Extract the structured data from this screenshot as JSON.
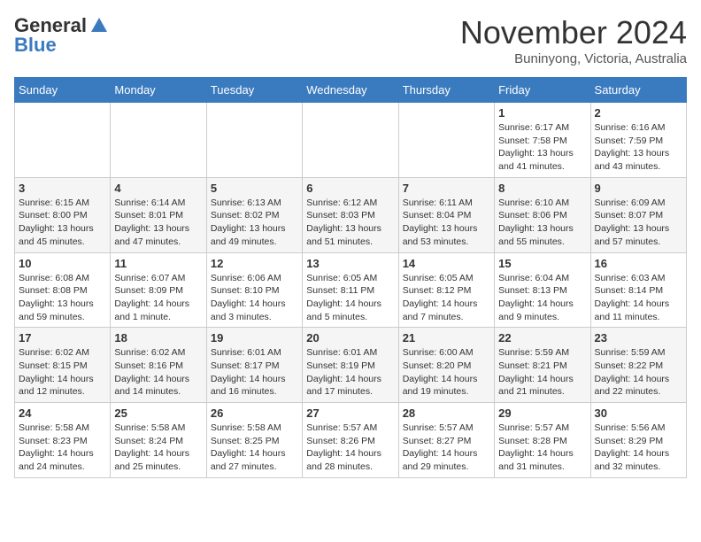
{
  "header": {
    "logo_general": "General",
    "logo_blue": "Blue",
    "month": "November 2024",
    "location": "Buninyong, Victoria, Australia"
  },
  "weekdays": [
    "Sunday",
    "Monday",
    "Tuesday",
    "Wednesday",
    "Thursday",
    "Friday",
    "Saturday"
  ],
  "weeks": [
    [
      {
        "day": "",
        "info": ""
      },
      {
        "day": "",
        "info": ""
      },
      {
        "day": "",
        "info": ""
      },
      {
        "day": "",
        "info": ""
      },
      {
        "day": "",
        "info": ""
      },
      {
        "day": "1",
        "info": "Sunrise: 6:17 AM\nSunset: 7:58 PM\nDaylight: 13 hours\nand 41 minutes."
      },
      {
        "day": "2",
        "info": "Sunrise: 6:16 AM\nSunset: 7:59 PM\nDaylight: 13 hours\nand 43 minutes."
      }
    ],
    [
      {
        "day": "3",
        "info": "Sunrise: 6:15 AM\nSunset: 8:00 PM\nDaylight: 13 hours\nand 45 minutes."
      },
      {
        "day": "4",
        "info": "Sunrise: 6:14 AM\nSunset: 8:01 PM\nDaylight: 13 hours\nand 47 minutes."
      },
      {
        "day": "5",
        "info": "Sunrise: 6:13 AM\nSunset: 8:02 PM\nDaylight: 13 hours\nand 49 minutes."
      },
      {
        "day": "6",
        "info": "Sunrise: 6:12 AM\nSunset: 8:03 PM\nDaylight: 13 hours\nand 51 minutes."
      },
      {
        "day": "7",
        "info": "Sunrise: 6:11 AM\nSunset: 8:04 PM\nDaylight: 13 hours\nand 53 minutes."
      },
      {
        "day": "8",
        "info": "Sunrise: 6:10 AM\nSunset: 8:06 PM\nDaylight: 13 hours\nand 55 minutes."
      },
      {
        "day": "9",
        "info": "Sunrise: 6:09 AM\nSunset: 8:07 PM\nDaylight: 13 hours\nand 57 minutes."
      }
    ],
    [
      {
        "day": "10",
        "info": "Sunrise: 6:08 AM\nSunset: 8:08 PM\nDaylight: 13 hours\nand 59 minutes."
      },
      {
        "day": "11",
        "info": "Sunrise: 6:07 AM\nSunset: 8:09 PM\nDaylight: 14 hours\nand 1 minute."
      },
      {
        "day": "12",
        "info": "Sunrise: 6:06 AM\nSunset: 8:10 PM\nDaylight: 14 hours\nand 3 minutes."
      },
      {
        "day": "13",
        "info": "Sunrise: 6:05 AM\nSunset: 8:11 PM\nDaylight: 14 hours\nand 5 minutes."
      },
      {
        "day": "14",
        "info": "Sunrise: 6:05 AM\nSunset: 8:12 PM\nDaylight: 14 hours\nand 7 minutes."
      },
      {
        "day": "15",
        "info": "Sunrise: 6:04 AM\nSunset: 8:13 PM\nDaylight: 14 hours\nand 9 minutes."
      },
      {
        "day": "16",
        "info": "Sunrise: 6:03 AM\nSunset: 8:14 PM\nDaylight: 14 hours\nand 11 minutes."
      }
    ],
    [
      {
        "day": "17",
        "info": "Sunrise: 6:02 AM\nSunset: 8:15 PM\nDaylight: 14 hours\nand 12 minutes."
      },
      {
        "day": "18",
        "info": "Sunrise: 6:02 AM\nSunset: 8:16 PM\nDaylight: 14 hours\nand 14 minutes."
      },
      {
        "day": "19",
        "info": "Sunrise: 6:01 AM\nSunset: 8:17 PM\nDaylight: 14 hours\nand 16 minutes."
      },
      {
        "day": "20",
        "info": "Sunrise: 6:01 AM\nSunset: 8:19 PM\nDaylight: 14 hours\nand 17 minutes."
      },
      {
        "day": "21",
        "info": "Sunrise: 6:00 AM\nSunset: 8:20 PM\nDaylight: 14 hours\nand 19 minutes."
      },
      {
        "day": "22",
        "info": "Sunrise: 5:59 AM\nSunset: 8:21 PM\nDaylight: 14 hours\nand 21 minutes."
      },
      {
        "day": "23",
        "info": "Sunrise: 5:59 AM\nSunset: 8:22 PM\nDaylight: 14 hours\nand 22 minutes."
      }
    ],
    [
      {
        "day": "24",
        "info": "Sunrise: 5:58 AM\nSunset: 8:23 PM\nDaylight: 14 hours\nand 24 minutes."
      },
      {
        "day": "25",
        "info": "Sunrise: 5:58 AM\nSunset: 8:24 PM\nDaylight: 14 hours\nand 25 minutes."
      },
      {
        "day": "26",
        "info": "Sunrise: 5:58 AM\nSunset: 8:25 PM\nDaylight: 14 hours\nand 27 minutes."
      },
      {
        "day": "27",
        "info": "Sunrise: 5:57 AM\nSunset: 8:26 PM\nDaylight: 14 hours\nand 28 minutes."
      },
      {
        "day": "28",
        "info": "Sunrise: 5:57 AM\nSunset: 8:27 PM\nDaylight: 14 hours\nand 29 minutes."
      },
      {
        "day": "29",
        "info": "Sunrise: 5:57 AM\nSunset: 8:28 PM\nDaylight: 14 hours\nand 31 minutes."
      },
      {
        "day": "30",
        "info": "Sunrise: 5:56 AM\nSunset: 8:29 PM\nDaylight: 14 hours\nand 32 minutes."
      }
    ]
  ]
}
